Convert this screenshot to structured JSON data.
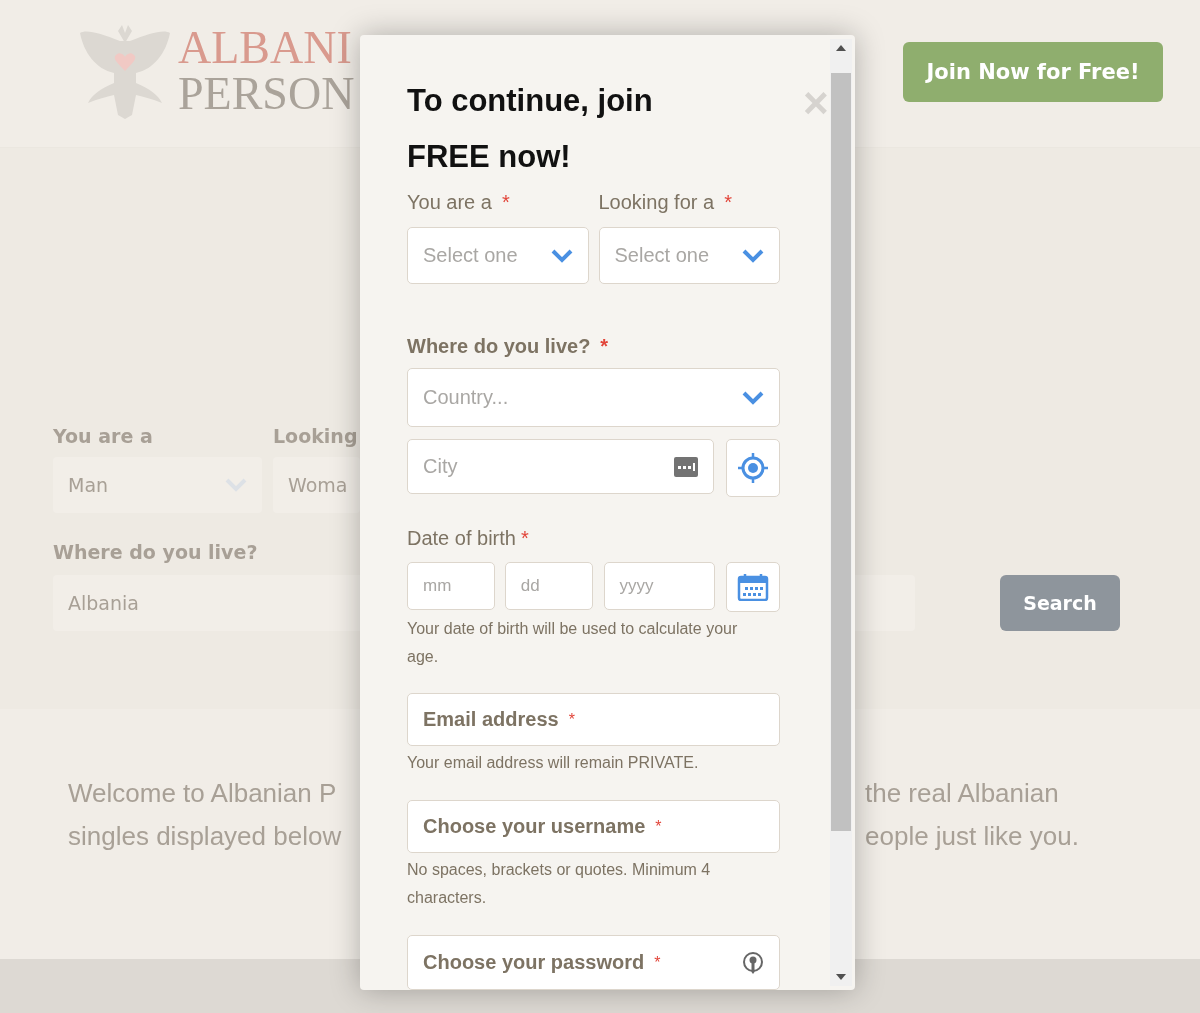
{
  "background": {
    "logo": {
      "line_1": "ALBANI",
      "line_2": "PERSON"
    },
    "join_button": "Join Now for Free!",
    "search_form": {
      "labels": [
        "You are a",
        "Looking"
      ],
      "selects": [
        "Man",
        "Woma"
      ],
      "location_label": "Where do you live?",
      "location_value": "Albania",
      "search_button": "Search"
    },
    "welcome": {
      "left_lines": [
        "Welcome to Albanian P",
        "singles displayed below"
      ],
      "right_lines": [
        "the real Albanian",
        "eople just like you."
      ]
    }
  },
  "modal": {
    "close": "×",
    "title": "To continue, join FREE now!",
    "required_mark": "*",
    "gender_row": [
      {
        "label": "You are a",
        "placeholder": "Select one"
      },
      {
        "label": "Looking for a",
        "placeholder": "Select one"
      }
    ],
    "location": {
      "label": "Where do you live?",
      "country_placeholder": "Country...",
      "city_placeholder": "City"
    },
    "birth": {
      "label": "Date of birth",
      "fields": [
        "mm",
        "dd",
        "yyyy"
      ],
      "help": "Your date of birth will be used to calculate your age."
    },
    "email": {
      "placeholder": "Email address",
      "help": "Your email address will remain PRIVATE."
    },
    "username": {
      "placeholder": "Choose your username",
      "help": "No spaces, brackets or quotes. Minimum 4 characters."
    },
    "password": {
      "placeholder": "Choose your password"
    }
  }
}
